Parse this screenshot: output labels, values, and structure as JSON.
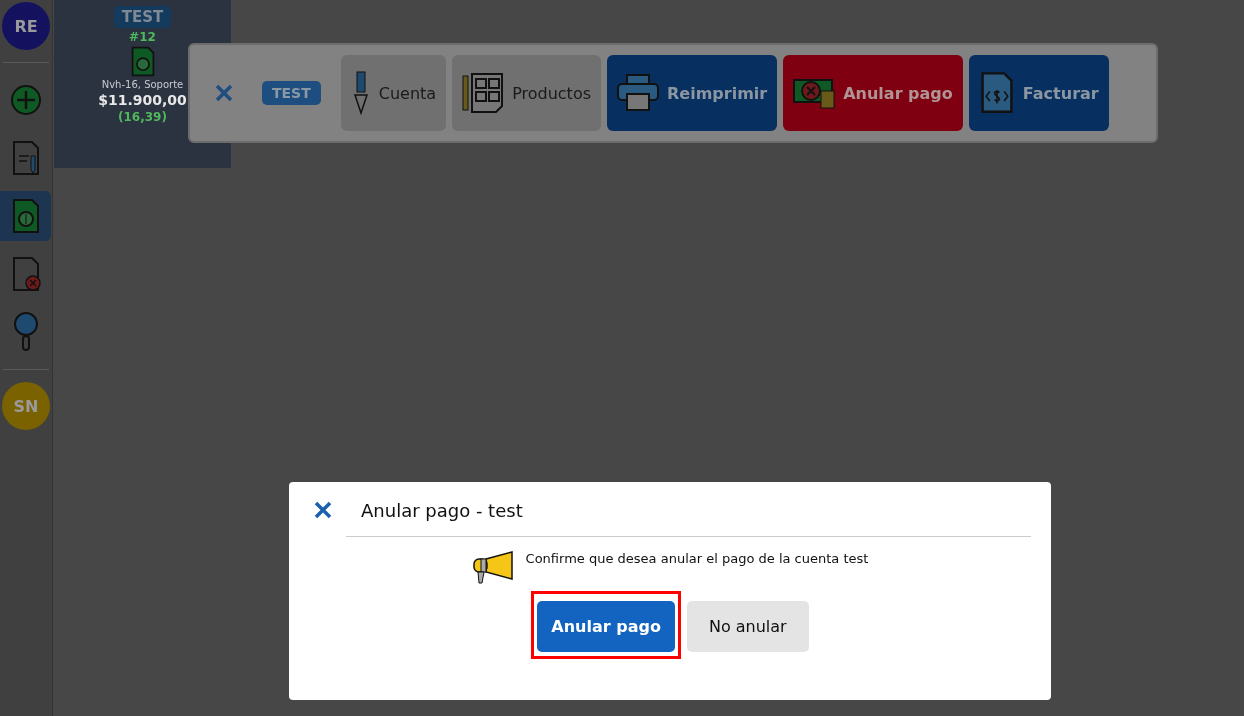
{
  "sidebar": {
    "top_avatar": "RE",
    "bottom_avatar": "SN",
    "items": [
      {
        "kind": "add",
        "selected": false
      },
      {
        "kind": "edit",
        "selected": false
      },
      {
        "kind": "money",
        "selected": true
      },
      {
        "kind": "cancel",
        "selected": false
      },
      {
        "kind": "search",
        "selected": false
      }
    ]
  },
  "account_card": {
    "tag": "TEST",
    "number": "#12",
    "detail": "Nvh-16, Soporte",
    "amount": "$11.900,00",
    "code": "(16,39)"
  },
  "toolbar": {
    "tag": "TEST",
    "buttons": [
      {
        "kind": "account",
        "label": "Cuenta"
      },
      {
        "kind": "products",
        "label": "Productos"
      },
      {
        "kind": "print",
        "label": "Reimprimir"
      },
      {
        "kind": "void",
        "label": "Anular pago"
      },
      {
        "kind": "invoice",
        "label": "Facturar"
      }
    ]
  },
  "dialog": {
    "title": "Anular pago - test",
    "message": "Confirme que desea anular el pago de la cuenta test",
    "confirm": {
      "label": "Anular pago",
      "highlighted": true
    },
    "cancel": {
      "label": "No anular"
    }
  }
}
